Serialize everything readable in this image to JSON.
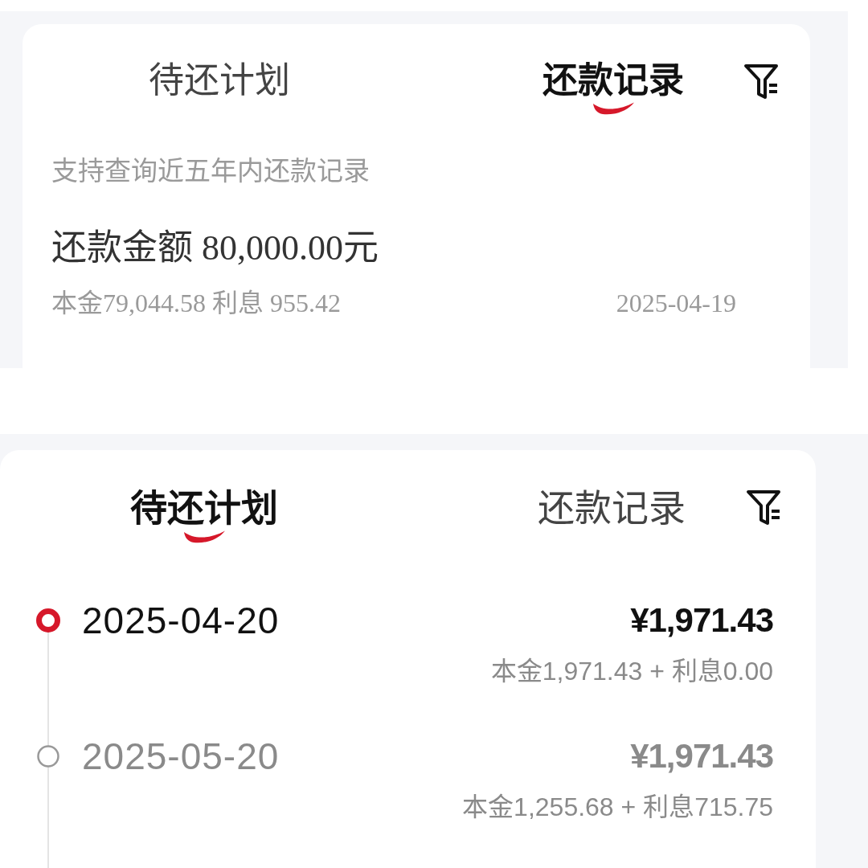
{
  "screens": [
    {
      "kind": "records",
      "tabs": [
        {
          "label": "待还计划",
          "selected": false
        },
        {
          "label": "还款记录",
          "selected": true
        }
      ],
      "hint": "支持查询近五年内还款记录",
      "records": [
        {
          "total": "还款金额 80,000.00元",
          "breakdown": "本金79,044.58 利息 955.42",
          "date": "2025-04-19"
        }
      ]
    },
    {
      "kind": "plan",
      "tabs": [
        {
          "label": "待还计划",
          "selected": true
        },
        {
          "label": "还款记录",
          "selected": false
        }
      ],
      "installments": [
        {
          "date": "2025-04-20",
          "amount": "¥1,971.43",
          "breakdown": "本金1,971.43 + 利息0.00",
          "current": true
        },
        {
          "date": "2025-05-20",
          "amount": "¥1,971.43",
          "breakdown": "本金1,255.68 + 利息715.75",
          "current": false
        }
      ]
    }
  ]
}
